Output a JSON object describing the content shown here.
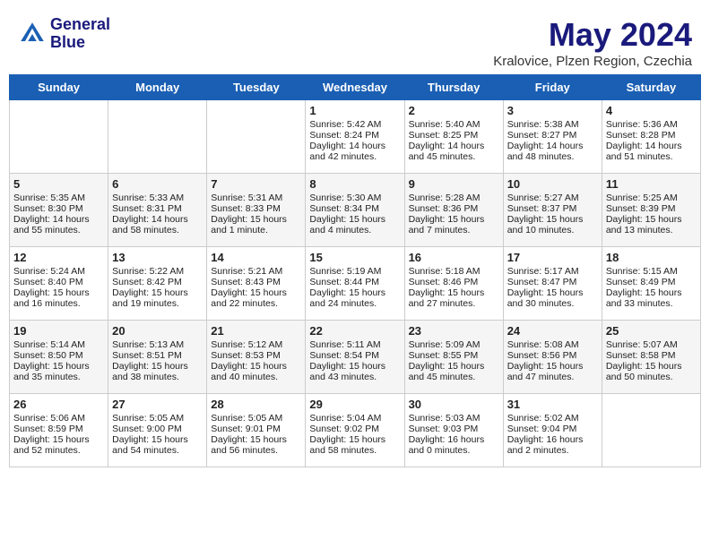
{
  "header": {
    "logo_line1": "General",
    "logo_line2": "Blue",
    "month": "May 2024",
    "location": "Kralovice, Plzen Region, Czechia"
  },
  "weekdays": [
    "Sunday",
    "Monday",
    "Tuesday",
    "Wednesday",
    "Thursday",
    "Friday",
    "Saturday"
  ],
  "weeks": [
    [
      {
        "day": "",
        "sunrise": "",
        "sunset": "",
        "daylight": ""
      },
      {
        "day": "",
        "sunrise": "",
        "sunset": "",
        "daylight": ""
      },
      {
        "day": "",
        "sunrise": "",
        "sunset": "",
        "daylight": ""
      },
      {
        "day": "1",
        "sunrise": "Sunrise: 5:42 AM",
        "sunset": "Sunset: 8:24 PM",
        "daylight": "Daylight: 14 hours and 42 minutes."
      },
      {
        "day": "2",
        "sunrise": "Sunrise: 5:40 AM",
        "sunset": "Sunset: 8:25 PM",
        "daylight": "Daylight: 14 hours and 45 minutes."
      },
      {
        "day": "3",
        "sunrise": "Sunrise: 5:38 AM",
        "sunset": "Sunset: 8:27 PM",
        "daylight": "Daylight: 14 hours and 48 minutes."
      },
      {
        "day": "4",
        "sunrise": "Sunrise: 5:36 AM",
        "sunset": "Sunset: 8:28 PM",
        "daylight": "Daylight: 14 hours and 51 minutes."
      }
    ],
    [
      {
        "day": "5",
        "sunrise": "Sunrise: 5:35 AM",
        "sunset": "Sunset: 8:30 PM",
        "daylight": "Daylight: 14 hours and 55 minutes."
      },
      {
        "day": "6",
        "sunrise": "Sunrise: 5:33 AM",
        "sunset": "Sunset: 8:31 PM",
        "daylight": "Daylight: 14 hours and 58 minutes."
      },
      {
        "day": "7",
        "sunrise": "Sunrise: 5:31 AM",
        "sunset": "Sunset: 8:33 PM",
        "daylight": "Daylight: 15 hours and 1 minute."
      },
      {
        "day": "8",
        "sunrise": "Sunrise: 5:30 AM",
        "sunset": "Sunset: 8:34 PM",
        "daylight": "Daylight: 15 hours and 4 minutes."
      },
      {
        "day": "9",
        "sunrise": "Sunrise: 5:28 AM",
        "sunset": "Sunset: 8:36 PM",
        "daylight": "Daylight: 15 hours and 7 minutes."
      },
      {
        "day": "10",
        "sunrise": "Sunrise: 5:27 AM",
        "sunset": "Sunset: 8:37 PM",
        "daylight": "Daylight: 15 hours and 10 minutes."
      },
      {
        "day": "11",
        "sunrise": "Sunrise: 5:25 AM",
        "sunset": "Sunset: 8:39 PM",
        "daylight": "Daylight: 15 hours and 13 minutes."
      }
    ],
    [
      {
        "day": "12",
        "sunrise": "Sunrise: 5:24 AM",
        "sunset": "Sunset: 8:40 PM",
        "daylight": "Daylight: 15 hours and 16 minutes."
      },
      {
        "day": "13",
        "sunrise": "Sunrise: 5:22 AM",
        "sunset": "Sunset: 8:42 PM",
        "daylight": "Daylight: 15 hours and 19 minutes."
      },
      {
        "day": "14",
        "sunrise": "Sunrise: 5:21 AM",
        "sunset": "Sunset: 8:43 PM",
        "daylight": "Daylight: 15 hours and 22 minutes."
      },
      {
        "day": "15",
        "sunrise": "Sunrise: 5:19 AM",
        "sunset": "Sunset: 8:44 PM",
        "daylight": "Daylight: 15 hours and 24 minutes."
      },
      {
        "day": "16",
        "sunrise": "Sunrise: 5:18 AM",
        "sunset": "Sunset: 8:46 PM",
        "daylight": "Daylight: 15 hours and 27 minutes."
      },
      {
        "day": "17",
        "sunrise": "Sunrise: 5:17 AM",
        "sunset": "Sunset: 8:47 PM",
        "daylight": "Daylight: 15 hours and 30 minutes."
      },
      {
        "day": "18",
        "sunrise": "Sunrise: 5:15 AM",
        "sunset": "Sunset: 8:49 PM",
        "daylight": "Daylight: 15 hours and 33 minutes."
      }
    ],
    [
      {
        "day": "19",
        "sunrise": "Sunrise: 5:14 AM",
        "sunset": "Sunset: 8:50 PM",
        "daylight": "Daylight: 15 hours and 35 minutes."
      },
      {
        "day": "20",
        "sunrise": "Sunrise: 5:13 AM",
        "sunset": "Sunset: 8:51 PM",
        "daylight": "Daylight: 15 hours and 38 minutes."
      },
      {
        "day": "21",
        "sunrise": "Sunrise: 5:12 AM",
        "sunset": "Sunset: 8:53 PM",
        "daylight": "Daylight: 15 hours and 40 minutes."
      },
      {
        "day": "22",
        "sunrise": "Sunrise: 5:11 AM",
        "sunset": "Sunset: 8:54 PM",
        "daylight": "Daylight: 15 hours and 43 minutes."
      },
      {
        "day": "23",
        "sunrise": "Sunrise: 5:09 AM",
        "sunset": "Sunset: 8:55 PM",
        "daylight": "Daylight: 15 hours and 45 minutes."
      },
      {
        "day": "24",
        "sunrise": "Sunrise: 5:08 AM",
        "sunset": "Sunset: 8:56 PM",
        "daylight": "Daylight: 15 hours and 47 minutes."
      },
      {
        "day": "25",
        "sunrise": "Sunrise: 5:07 AM",
        "sunset": "Sunset: 8:58 PM",
        "daylight": "Daylight: 15 hours and 50 minutes."
      }
    ],
    [
      {
        "day": "26",
        "sunrise": "Sunrise: 5:06 AM",
        "sunset": "Sunset: 8:59 PM",
        "daylight": "Daylight: 15 hours and 52 minutes."
      },
      {
        "day": "27",
        "sunrise": "Sunrise: 5:05 AM",
        "sunset": "Sunset: 9:00 PM",
        "daylight": "Daylight: 15 hours and 54 minutes."
      },
      {
        "day": "28",
        "sunrise": "Sunrise: 5:05 AM",
        "sunset": "Sunset: 9:01 PM",
        "daylight": "Daylight: 15 hours and 56 minutes."
      },
      {
        "day": "29",
        "sunrise": "Sunrise: 5:04 AM",
        "sunset": "Sunset: 9:02 PM",
        "daylight": "Daylight: 15 hours and 58 minutes."
      },
      {
        "day": "30",
        "sunrise": "Sunrise: 5:03 AM",
        "sunset": "Sunset: 9:03 PM",
        "daylight": "Daylight: 16 hours and 0 minutes."
      },
      {
        "day": "31",
        "sunrise": "Sunrise: 5:02 AM",
        "sunset": "Sunset: 9:04 PM",
        "daylight": "Daylight: 16 hours and 2 minutes."
      },
      {
        "day": "",
        "sunrise": "",
        "sunset": "",
        "daylight": ""
      }
    ]
  ]
}
